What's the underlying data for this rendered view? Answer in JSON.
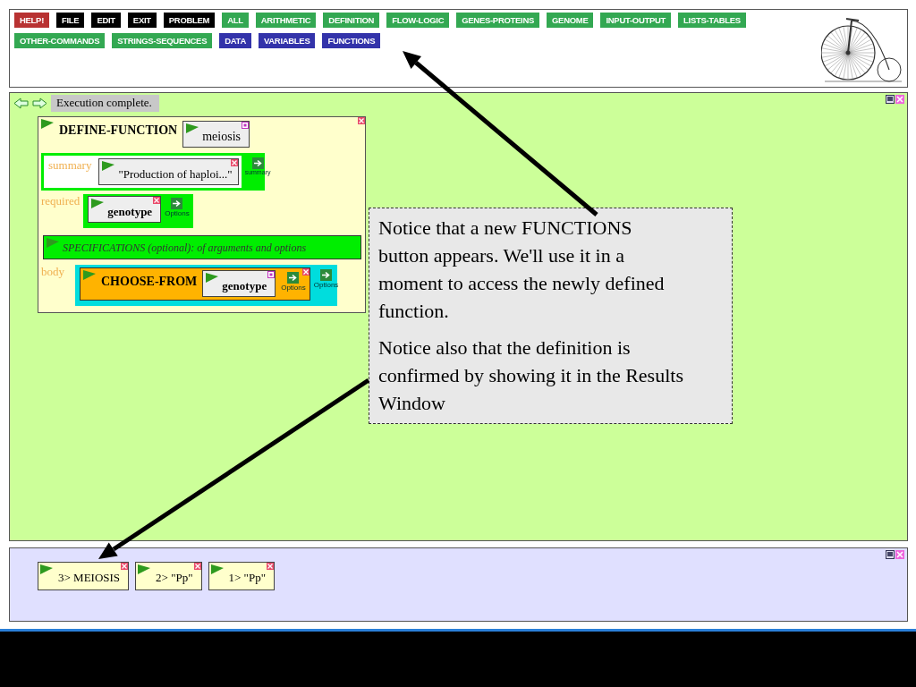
{
  "toolbar": {
    "buttons": [
      {
        "label": "HELP!",
        "color": "#b83232"
      },
      {
        "label": "FILE",
        "color": "#000000"
      },
      {
        "label": "EDIT",
        "color": "#000000"
      },
      {
        "label": "EXIT",
        "color": "#000000"
      },
      {
        "label": "PROBLEM",
        "color": "#000000"
      },
      {
        "label": "ALL",
        "color": "#33a852"
      },
      {
        "label": "ARITHMETIC",
        "color": "#33a852"
      },
      {
        "label": "DEFINITION",
        "color": "#33a852"
      },
      {
        "label": "FLOW-LOGIC",
        "color": "#33a852"
      },
      {
        "label": "GENES-PROTEINS",
        "color": "#33a852"
      },
      {
        "label": "GENOME",
        "color": "#33a852"
      },
      {
        "label": "INPUT-OUTPUT",
        "color": "#33a852"
      },
      {
        "label": "LISTS-TABLES",
        "color": "#33a852"
      },
      {
        "label": "OTHER-COMMANDS",
        "color": "#33a852"
      },
      {
        "label": "STRINGS-SEQUENCES",
        "color": "#33a852"
      },
      {
        "label": "DATA",
        "color": "#3333aa"
      },
      {
        "label": "VARIABLES",
        "color": "#3333aa"
      },
      {
        "label": "FUNCTIONS",
        "color": "#3333aa"
      }
    ]
  },
  "workspace": {
    "status": "Execution complete.",
    "define_function": {
      "title": "DEFINE-FUNCTION",
      "name": "meiosis",
      "summary_label": "summary",
      "summary_value": "\"Production of haploi...\"",
      "summary_button": "summary",
      "required_label": "required",
      "required_value": "genotype",
      "required_button": "Options",
      "specifications": "SPECIFICATIONS (optional): of arguments and options",
      "body_label": "body",
      "body_title": "CHOOSE-FROM",
      "body_value": "genotype",
      "body_inner_button": "Options",
      "body_outer_button": "Options"
    }
  },
  "callout": {
    "paragraphs": [
      "Notice that a new FUNCTIONS button appears. We'll use it in a moment to access the newly defined function.",
      "Notice also that the definition is confirmed by showing it in the Results Window"
    ]
  },
  "results": {
    "items": [
      "3> MEIOSIS",
      "2> \"Pp\"",
      "1> \"Pp\""
    ]
  }
}
